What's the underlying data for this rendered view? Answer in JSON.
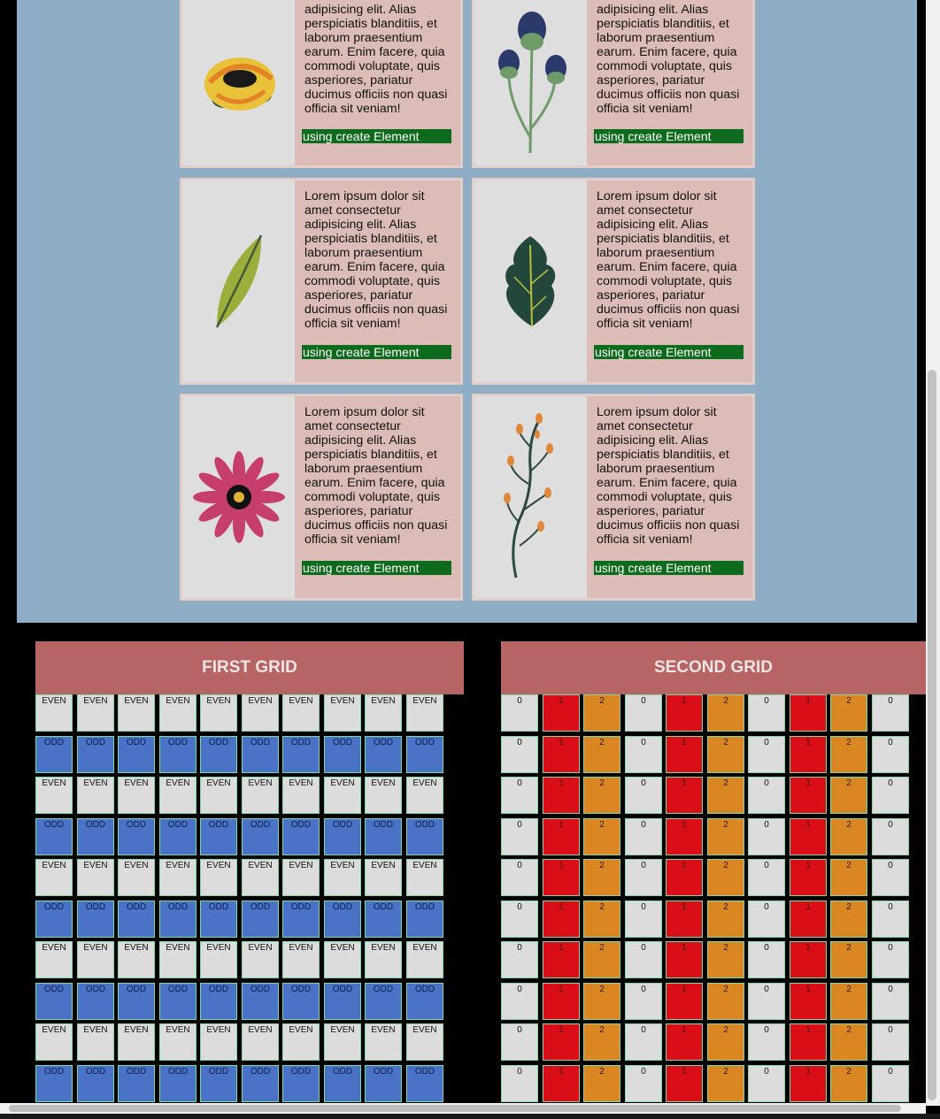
{
  "cards": [
    {
      "image": "yellow-rose-icon",
      "text": "adipisicing elit. Alias perspiciatis blanditiis, et laborum praesentium earum. Enim facere, quia commodi voluptate, quis asperiores, pariatur ducimus officiis non quasi officia sit veniam!",
      "button": "using create Element"
    },
    {
      "image": "blue-thistle-icon",
      "text": "adipisicing elit. Alias perspiciatis blanditiis, et laborum praesentium earum. Enim facere, quia commodi voluptate, quis asperiores, pariatur ducimus officiis non quasi officia sit veniam!",
      "button": "using create Element"
    },
    {
      "image": "green-leaf-icon",
      "text": "Lorem ipsum dolor sit amet consectetur adipisicing elit. Alias perspiciatis blanditiis, et laborum praesentium earum. Enim facere, quia commodi voluptate, quis asperiores, pariatur ducimus officiis non quasi officia sit veniam!",
      "button": "using create Element"
    },
    {
      "image": "oak-leaf-icon",
      "text": "Lorem ipsum dolor sit amet consectetur adipisicing elit. Alias perspiciatis blanditiis, et laborum praesentium earum. Enim facere, quia commodi voluptate, quis asperiores, pariatur ducimus officiis non quasi officia sit veniam!",
      "button": "using create Element"
    },
    {
      "image": "pink-daisy-icon",
      "text": "Lorem ipsum dolor sit amet consectetur adipisicing elit. Alias perspiciatis blanditiis, et laborum praesentium earum. Enim facere, quia commodi voluptate, quis asperiores, pariatur ducimus officiis non quasi officia sit veniam!",
      "button": "using create Element"
    },
    {
      "image": "orange-berry-branch-icon",
      "text": "Lorem ipsum dolor sit amet consectetur adipisicing elit. Alias perspiciatis blanditiis, et laborum praesentium earum. Enim facere, quia commodi voluptate, quis asperiores, pariatur ducimus officiis non quasi officia sit veniam!",
      "button": "using create Element"
    }
  ],
  "first_grid": {
    "title": "FIRST GRID",
    "row_labels": [
      "EVEN",
      "ODD",
      "EVEN",
      "ODD",
      "EVEN",
      "ODD",
      "EVEN",
      "ODD",
      "EVEN",
      "ODD"
    ],
    "cols": 10
  },
  "second_grid": {
    "title": "SECOND GRID",
    "col_labels": [
      "0",
      "1",
      "2",
      "0",
      "1",
      "2",
      "0",
      "1",
      "2",
      "0"
    ],
    "rows": 10
  },
  "colors": {
    "section_bg": "#8fadc5",
    "card_bg": "#dcbcb6",
    "button_bg": "#0e6a1d",
    "grid_header_bg": "#b76464",
    "odd_cell": "#4a72c6",
    "even_cell": "#dcdcdc",
    "one_cell": "#d90e16",
    "two_cell": "#da8622"
  }
}
